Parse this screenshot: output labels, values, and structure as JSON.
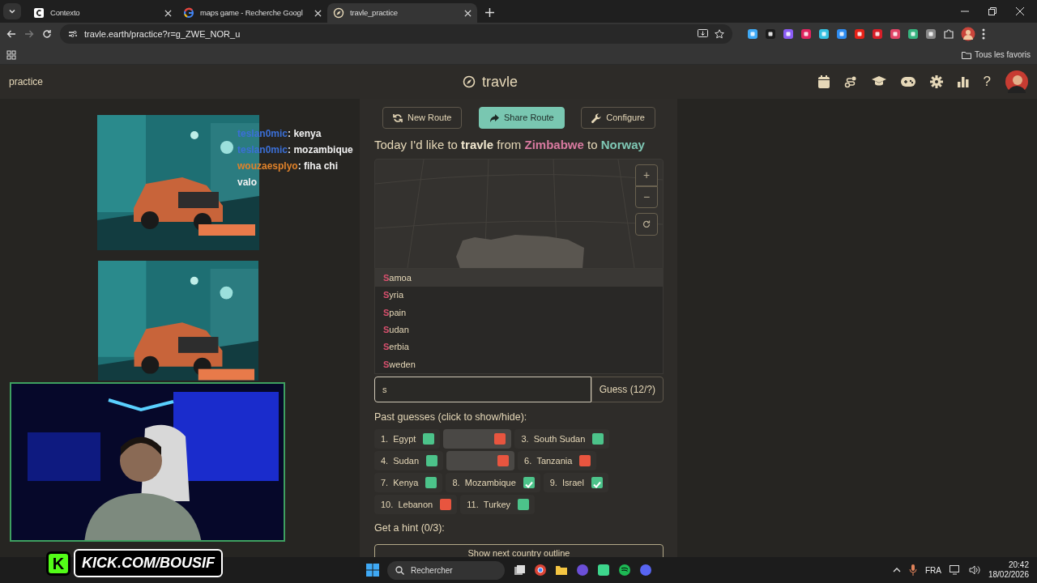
{
  "browser": {
    "tabs": [
      {
        "title": "Contexto",
        "selected": false
      },
      {
        "title": "maps game - Recherche Googl",
        "selected": false
      },
      {
        "title": "travle_practice",
        "selected": true
      }
    ],
    "url": "travle.earth/practice?r=g_ZWE_NOR_u",
    "bookmarks_folder": "Tous les favoris"
  },
  "navbar": {
    "mode": "practice",
    "brand": "travle",
    "help": "?"
  },
  "actions": [
    {
      "label": "New Route",
      "kind": "outline"
    },
    {
      "label": "Share Route",
      "kind": "primary"
    },
    {
      "label": "Configure",
      "kind": "outline"
    }
  ],
  "prompt": [
    {
      "text": "Today I'd like to ",
      "kind": "plain"
    },
    {
      "text": "travle",
      "kind": "bold"
    },
    {
      "text": " from ",
      "kind": "plain"
    },
    {
      "text": "Zimbabwe",
      "kind": "start"
    },
    {
      "text": " to ",
      "kind": "plain"
    },
    {
      "text": "Norway",
      "kind": "end"
    }
  ],
  "map_controls": [
    "+",
    "−"
  ],
  "suggestions": [
    {
      "match": "S",
      "rest": "amoa",
      "selected": true
    },
    {
      "match": "S",
      "rest": "yria",
      "selected": false
    },
    {
      "match": "S",
      "rest": "pain",
      "selected": false
    },
    {
      "match": "S",
      "rest": "udan",
      "selected": false
    },
    {
      "match": "S",
      "rest": "erbia",
      "selected": false
    },
    {
      "match": "S",
      "rest": "weden",
      "selected": false
    }
  ],
  "guess_input": {
    "value": "s"
  },
  "guess_button": "Guess (12/?)",
  "past_guesses_label": "Past guesses (click to show/hide):",
  "guesses": [
    {
      "number": "1.",
      "name": "Egypt",
      "color": "#4cc38a",
      "hidden": false,
      "checked": false
    },
    {
      "color": "#e8553f",
      "hidden": true,
      "checked": false
    },
    {
      "number": "3.",
      "name": "South Sudan",
      "color": "#4cc38a",
      "hidden": false,
      "checked": false
    },
    {
      "number": "4.",
      "name": "Sudan",
      "color": "#4cc38a",
      "hidden": false,
      "checked": false
    },
    {
      "color": "#e8553f",
      "hidden": true,
      "checked": false
    },
    {
      "number": "6.",
      "name": "Tanzania",
      "color": "#e8553f",
      "hidden": false,
      "checked": false
    },
    {
      "number": "7.",
      "name": "Kenya",
      "color": "#4cc38a",
      "hidden": false,
      "checked": false
    },
    {
      "number": "8.",
      "name": "Mozambique",
      "color": "#4cc38a",
      "hidden": false,
      "checked": true
    },
    {
      "number": "9.",
      "name": "Israel",
      "color": "#4cc38a",
      "hidden": false,
      "checked": true
    },
    {
      "number": "10.",
      "name": "Lebanon",
      "color": "#e8553f",
      "hidden": false,
      "checked": false
    },
    {
      "number": "11.",
      "name": "Turkey",
      "color": "#4cc38a",
      "hidden": false,
      "checked": false
    }
  ],
  "hint_label": "Get a hint (0/3):",
  "hint_button": "Show next country outline",
  "stream": {
    "chat": [
      {
        "user": "teslan0mic",
        "color": "#3b6fd6",
        "separator": ":",
        "message": "kenya"
      },
      {
        "user": "teslan0mic",
        "color": "#3b6fd6",
        "separator": ":",
        "message": "mozambique"
      },
      {
        "user": "wouzaesplyo",
        "color": "#e0822a",
        "separator": ":",
        "message": "fiha chi valo"
      }
    ],
    "logo_letter": "K",
    "overlay_label": "KICK.COM/BOUSIF"
  },
  "taskbar": {
    "search": "Rechercher",
    "language": "FRA",
    "time": "20:42",
    "date": "18/02/2026"
  }
}
